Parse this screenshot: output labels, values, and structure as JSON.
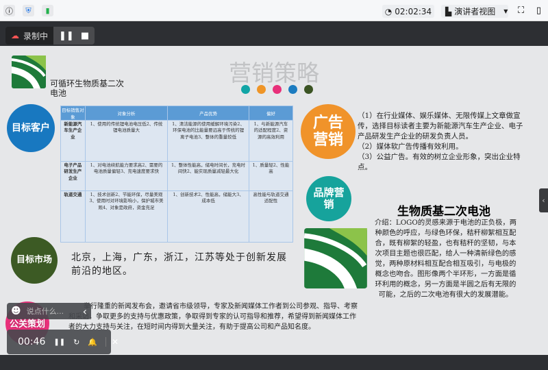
{
  "topbar": {
    "timer": "02:02:34",
    "presenter_view": "演讲者视图"
  },
  "recording": {
    "label": "录制中"
  },
  "slide": {
    "company": "可循环生物质基二次电池",
    "title": "营销策略",
    "dot_colors": [
      "#11a5a6",
      "#ef9527",
      "#e8307a",
      "#1c7cc0",
      "#3b5423"
    ],
    "circles": {
      "target_customer": "目标客户",
      "advert": "广告营销",
      "brand": "品牌营销",
      "market": "目标市场",
      "pr": "公关策划"
    },
    "table": {
      "headers": [
        "目标销售对象",
        "对象分析",
        "产品优势",
        "偏好"
      ],
      "rows": [
        [
          "新能源汽车生产企业",
          "1、使用的传统锂电池电压低2、传统锂电池质量大",
          "1、清洁能源的使用缓解环境污染2、环保电池的比能量要远高于传统的锂离子电池3、整体的重量较低",
          "1、与新能源汽车的适配程度2、资源的高效利用"
        ],
        [
          "电子产品研发生产企业",
          "1、对电池续航能力要求高2、需要的电池质量偏轻3、充电速度要求快",
          "1、整体性能高，储电时间长，充电时间快2、能实现质量减轻最大化",
          "1、质量轻2、性能高"
        ],
        [
          "轨道交通",
          "1、技术创新2、节能环保，尽量美观3、使用时对环境影响小，保护城市美观4、对象是政府，资金充足",
          "1、创新技术2、性能高，储能大3、成本低",
          "高性能与轨道交通适配性"
        ]
      ]
    },
    "advert_text": [
      "（1）在行业媒体、娱乐媒体、无限传媒上文章做宣传，选择目标读者主要为新能源汽车生产企业、电子产品研发生产企业的研发负责人员。",
      "（2）媒体软广告传播有效利用。",
      "（3）公益广告。有效的树立企业形象，突出企业特点。"
    ],
    "product_title": "生物质基二次电池",
    "product_desc": "介绍：LOGO的灵感来源于电池的正负极，两种颜色的呼应，与绿色环保，秸秆柳絮相互配合，既有柳絮的轻盈，也有秸秆的坚韧，与本次项目主题也很匹配，给人一种清新绿色的感觉，两种原材料相互配合相互吸引，与电极的概念也吻合。图形像两个半环形，一方面是循环利用的概念，另一方面是半圆之后有无限的可能，之后的二次电池有很大的发展潜能。",
    "market_text": "北京，上海，广东，浙江，江苏等处于创新发展前沿的地区。",
    "pr_text": "举行隆重的新闻发布会，邀请省市级领导，专家及新闻媒体工作者到公司参观、指导、考察和采访，争取更多的支持与优惠政策，争取得到专家的认可指导和推荐，希望得到新闻媒体工作者的大力支持与关注，在短时间内得到大量关注，有助于提高公司和产品知名度。"
  },
  "overlay": {
    "comment_placeholder": "说点什么...",
    "elapsed": "00:46"
  }
}
